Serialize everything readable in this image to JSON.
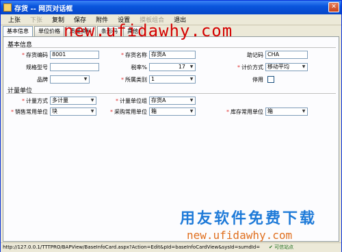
{
  "window": {
    "title": "存货 -- 网页对话框"
  },
  "menu": [
    {
      "label": "上张",
      "disabled": false
    },
    {
      "label": "下张",
      "disabled": true
    },
    {
      "label": "复制",
      "disabled": false
    },
    {
      "label": "保存",
      "disabled": false
    },
    {
      "label": "附件",
      "disabled": false
    },
    {
      "label": "设置",
      "disabled": false
    },
    {
      "label": "摸板组合",
      "disabled": true
    },
    {
      "label": "退出",
      "disabled": false
    }
  ],
  "tabs": [
    "基本信息",
    "单位价格",
    "质量资料",
    "条形码",
    "其他"
  ],
  "sections": {
    "basic": "基本信息",
    "unit": "计量单位"
  },
  "fields": {
    "code": {
      "label": "存货编码",
      "value": "8001"
    },
    "name": {
      "label": "存货名称",
      "value": "存货A"
    },
    "mnemonic": {
      "label": "助记码",
      "value": "CHA"
    },
    "spec": {
      "label": "规格型号",
      "value": ""
    },
    "tax": {
      "label": "税率%",
      "value": "17"
    },
    "pricing": {
      "label": "计价方式",
      "value": "移动平均"
    },
    "brand": {
      "label": "品牌",
      "value": ""
    },
    "category": {
      "label": "所属类别",
      "value": "1"
    },
    "disabled": {
      "label": "停用",
      "value": ""
    },
    "measure_mode": {
      "label": "计量方式",
      "value": "多计量"
    },
    "unit_group": {
      "label": "计量单位组",
      "value": "存货A"
    },
    "sales_unit": {
      "label": "销售常用单位",
      "value": "块"
    },
    "purchase_unit": {
      "label": "采购常用单位",
      "value": "箱"
    },
    "stock_unit": {
      "label": "库存常用单位",
      "value": "箱"
    }
  },
  "watermark": {
    "top": "new.ufidawhy.com",
    "bottom_title": "用友软件免费下载",
    "bottom_url": "new.ufidawhy.com"
  },
  "status": {
    "url": "http://127.0.0.1/TTTPRO/BAPView/BaseInfoCard.aspx?Action=Edit&pId=baseInfoCardView&sysId=sumdId=",
    "zone": "✔ 可信站点"
  },
  "colors": {
    "required": "#e03030",
    "watermark_red": "#d40000",
    "watermark_blue": "#1e7ad8",
    "watermark_orange": "#e07020"
  }
}
